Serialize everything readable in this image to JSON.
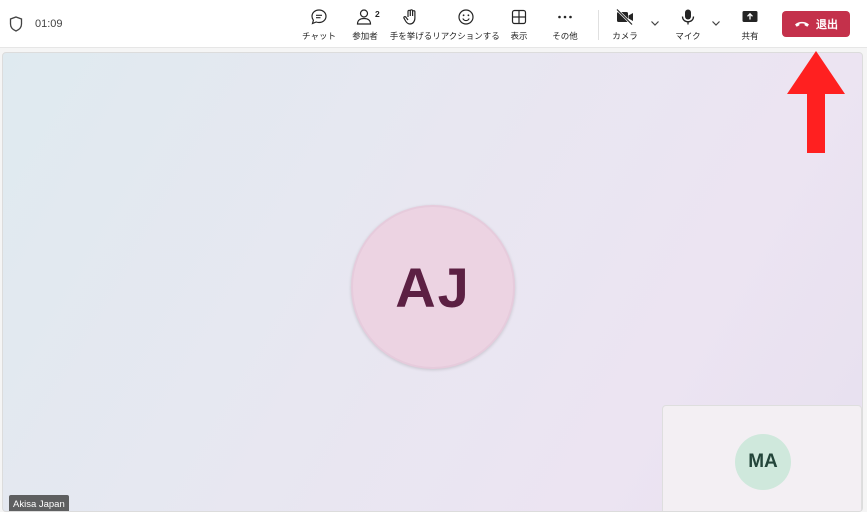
{
  "meeting": {
    "timer": "01:09"
  },
  "toolbar": {
    "chat_label": "チャット",
    "participants_label": "参加者",
    "participants_count": "2",
    "raise_hand_label": "手を挙げる",
    "react_label": "リアクションする",
    "view_label": "表示",
    "more_label": "その他",
    "camera_label": "カメラ",
    "mic_label": "マイク",
    "share_label": "共有",
    "leave_label": "退出"
  },
  "stage": {
    "main_participant": {
      "initials": "AJ",
      "name": "Akisa Japan"
    },
    "self_participant": {
      "initials": "MA"
    }
  },
  "colors": {
    "leave": "#c4314b",
    "annotation_arrow": "#ff2020",
    "main_avatar_bg": "#ecd3e2",
    "self_avatar_bg": "#cfe8dc"
  }
}
